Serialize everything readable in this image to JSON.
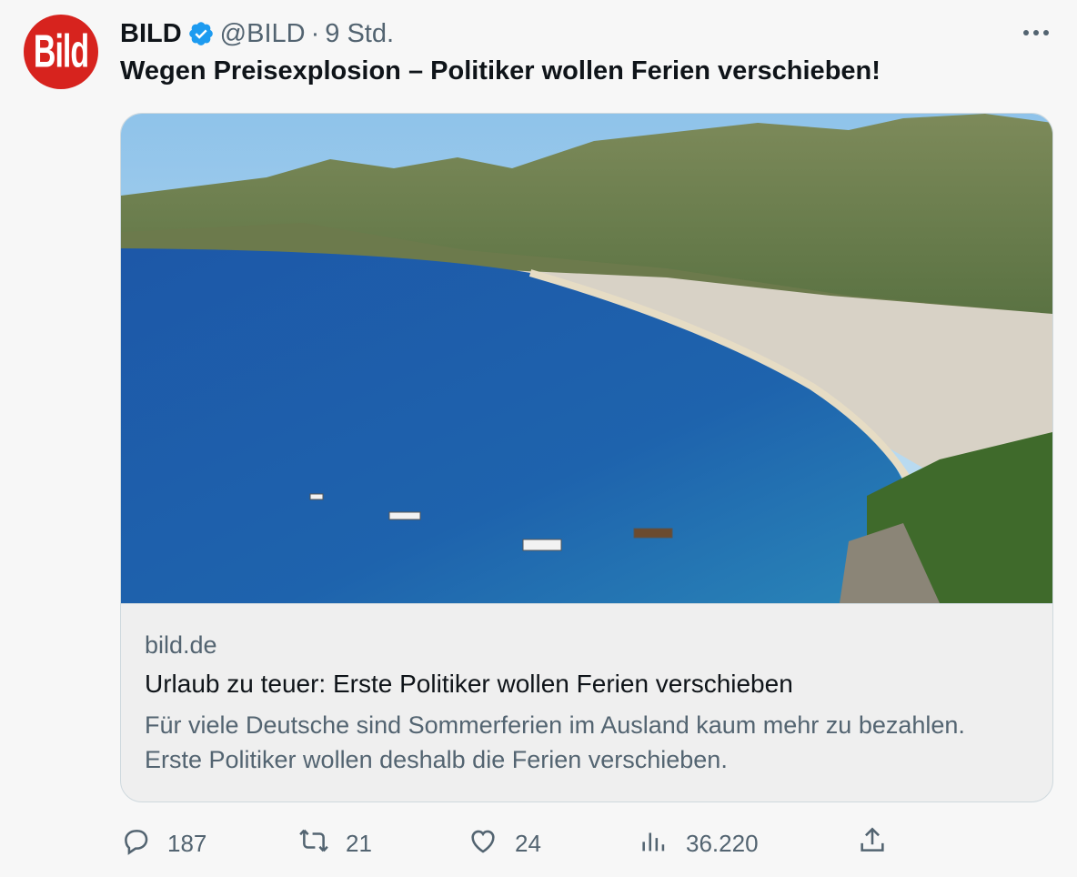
{
  "tweet": {
    "author_name": "BILD",
    "handle": "@BILD",
    "separator": "·",
    "time": "9 Std.",
    "text": "Wegen Preisexplosion – Politiker wollen Ferien verschieben!",
    "avatar_logo_text": "Bild",
    "verified_color": "#1d9bf0"
  },
  "card": {
    "domain": "bild.de",
    "title": "Urlaub zu teuer: Erste Politiker wollen Ferien verschieben",
    "description": "Für viele Deutsche sind Sommerferien im Ausland kaum mehr zu bezahlen. Erste Politiker wollen deshalb die Ferien verschieben."
  },
  "actions": {
    "replies": "187",
    "retweets": "21",
    "likes": "24",
    "views": "36.220"
  },
  "icons": [
    "verified-badge-icon",
    "more-icon",
    "reply-icon",
    "retweet-icon",
    "like-icon",
    "views-icon",
    "share-icon"
  ]
}
